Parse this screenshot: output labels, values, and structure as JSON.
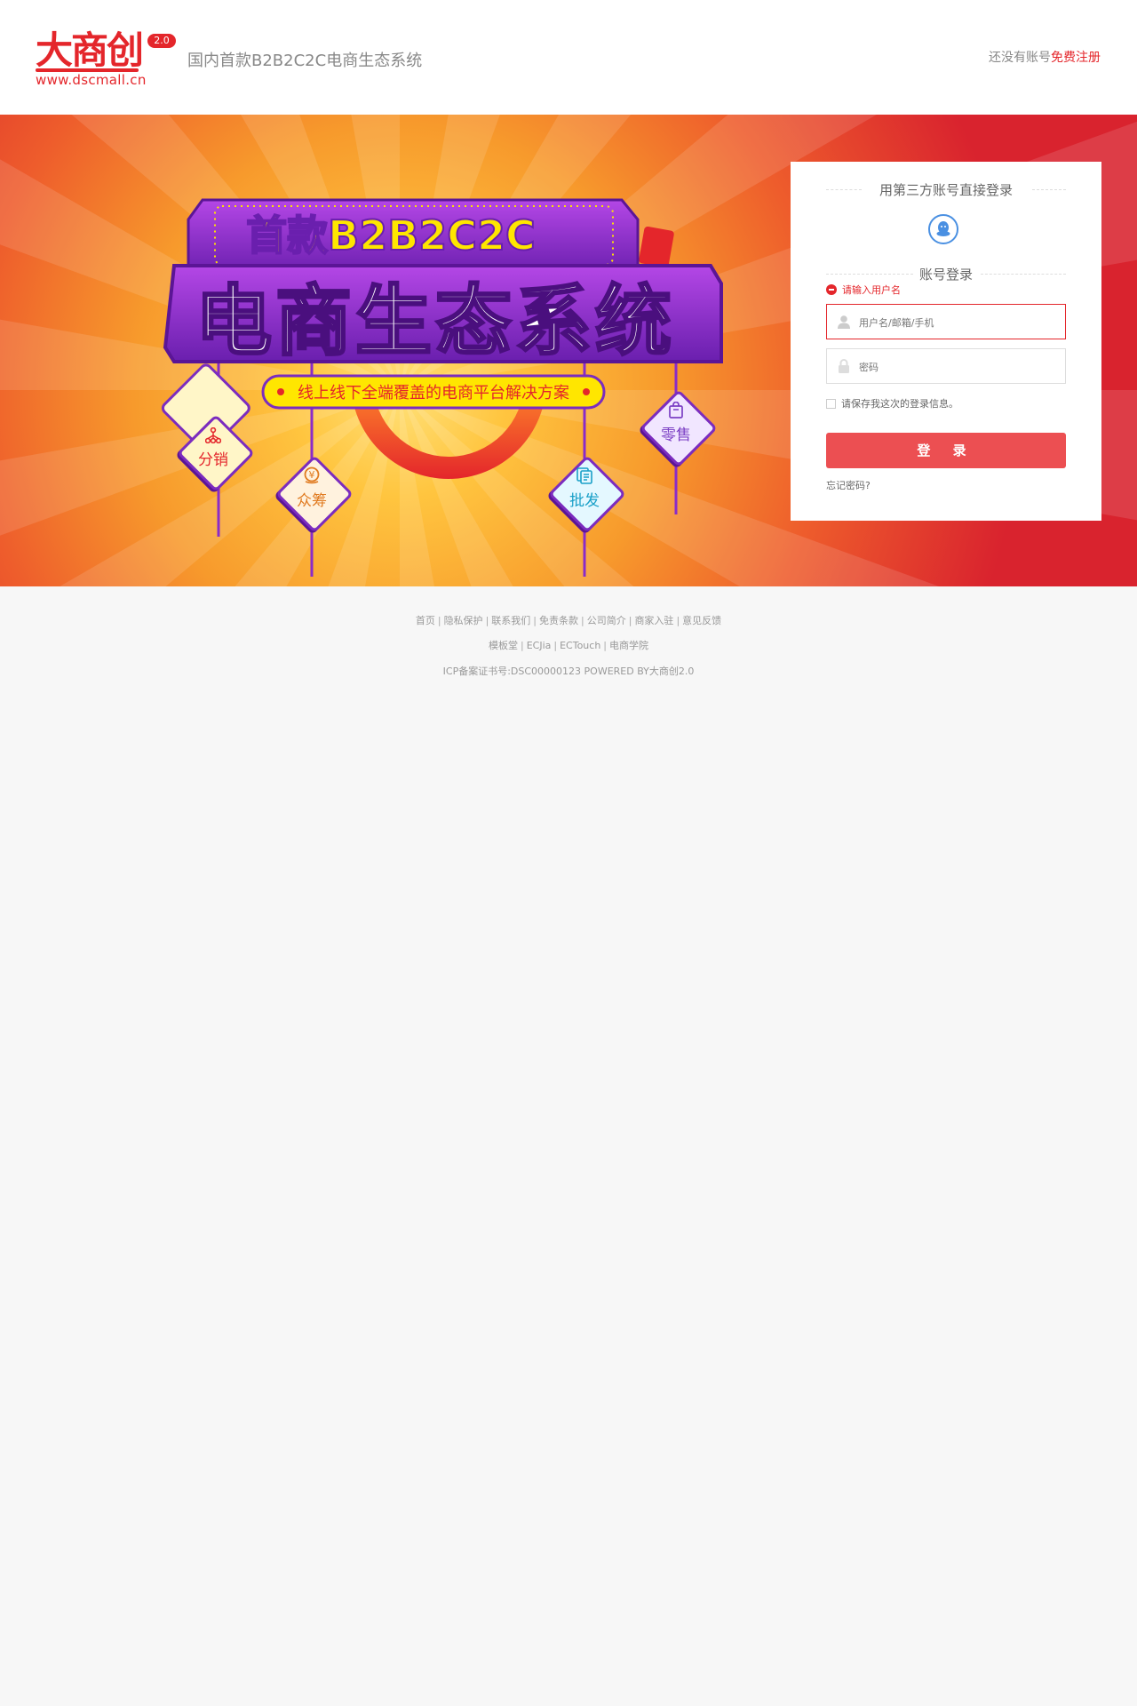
{
  "header": {
    "logo_text": "大商创",
    "logo_url": "www.dscmall.cn",
    "logo_version": "2.0",
    "tagline": "国内首款B2B2C2C电商生态系统",
    "register_prompt": "还没有账号",
    "register_link": "免费注册"
  },
  "banner": {
    "headline_top": "首款B2B2C2C",
    "headline_main": "电商生态系统",
    "ribbon": "线上线下全端覆盖的电商平台解决方案",
    "badges": [
      {
        "label": "分销",
        "icon": "network-icon",
        "color": "#e4262b"
      },
      {
        "label": "众筹",
        "icon": "yen-coin-icon",
        "color": "#e07a1f"
      },
      {
        "label": "批发",
        "icon": "documents-icon",
        "color": "#1aa0c8"
      },
      {
        "label": "零售",
        "icon": "shopping-bag-icon",
        "color": "#7b3fc4"
      }
    ]
  },
  "login": {
    "third_party_title": "用第三方账号直接登录",
    "account_title": "账号登录",
    "error": "请输入用户名",
    "username_placeholder": "用户名/邮箱/手机",
    "password_placeholder": "密码",
    "remember": "请保存我这次的登录信息。",
    "submit": "登 录",
    "forgot": "忘记密码?"
  },
  "footer": {
    "links_row1": [
      "首页",
      "隐私保护",
      "联系我们",
      "免责条款",
      "公司简介",
      "商家入驻",
      "意见反馈"
    ],
    "links_row2": [
      "模板堂",
      "ECJia",
      "ECTouch",
      "电商学院"
    ],
    "copyright": "ICP备案证书号:DSC00000123 POWERED BY大商创2.0"
  },
  "colors": {
    "brand_red": "#e4262b",
    "button_red": "#ec4f52",
    "qq_blue": "#4a90e2",
    "banner_purple": "#7b2cbf",
    "banner_yellow": "#ffe600"
  }
}
